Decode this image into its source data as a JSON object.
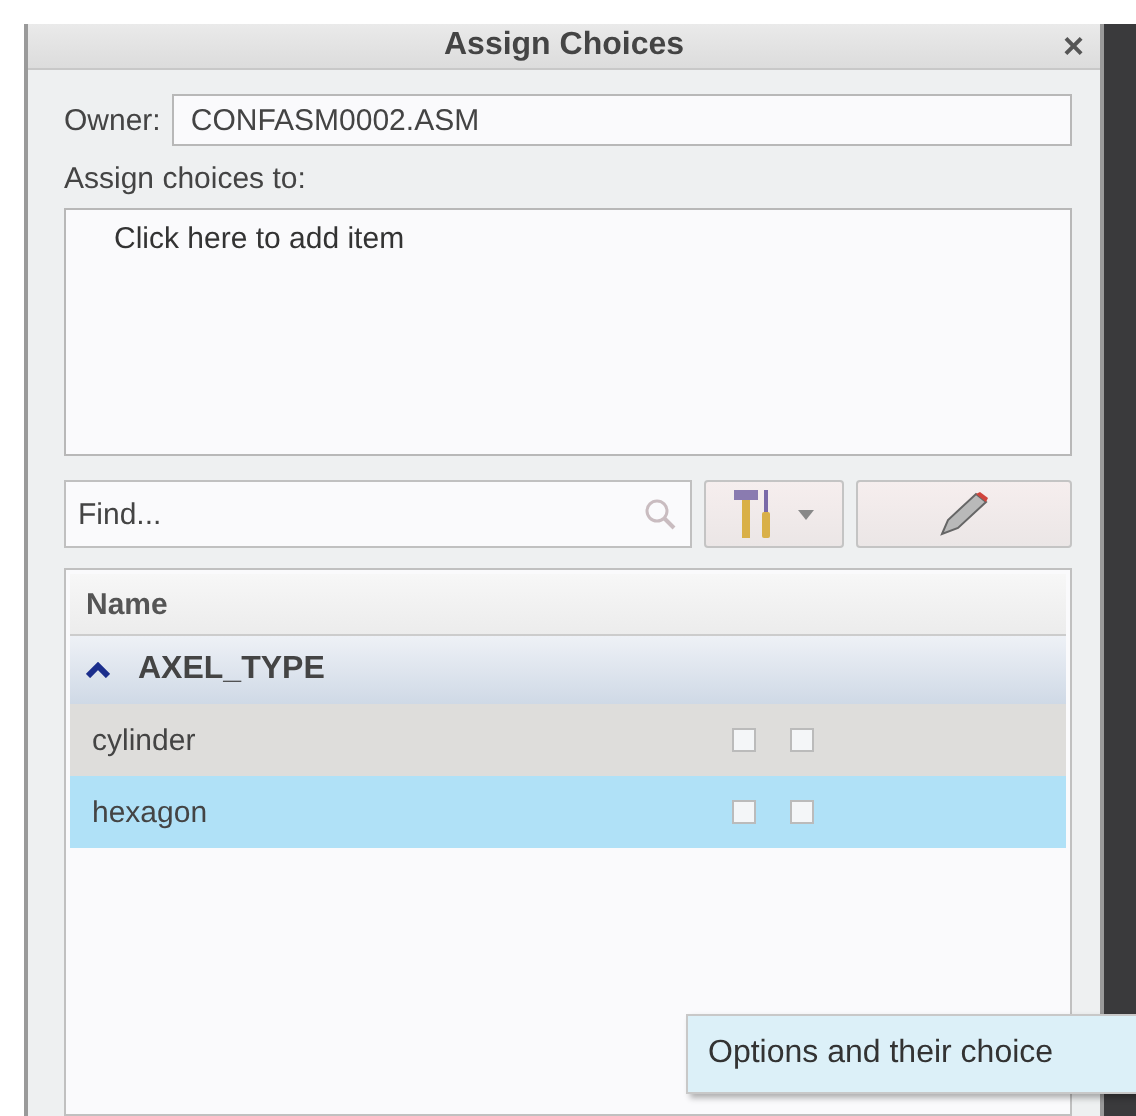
{
  "window": {
    "title": "Assign Choices",
    "close": "×"
  },
  "owner": {
    "label": "Owner:",
    "value": "CONFASM0002.ASM"
  },
  "assign": {
    "label": "Assign choices to:",
    "items": [
      "Click here to add item"
    ]
  },
  "find": {
    "placeholder": "Find..."
  },
  "table": {
    "columns": [
      "Name"
    ],
    "groups": [
      {
        "name": "AXEL_TYPE",
        "expanded": true,
        "rows": [
          {
            "name": "cylinder",
            "selected": false,
            "checks": [
              false,
              false
            ]
          },
          {
            "name": "hexagon",
            "selected": true,
            "checks": [
              false,
              false
            ]
          }
        ]
      }
    ]
  },
  "tooltip": "Options and their choice"
}
